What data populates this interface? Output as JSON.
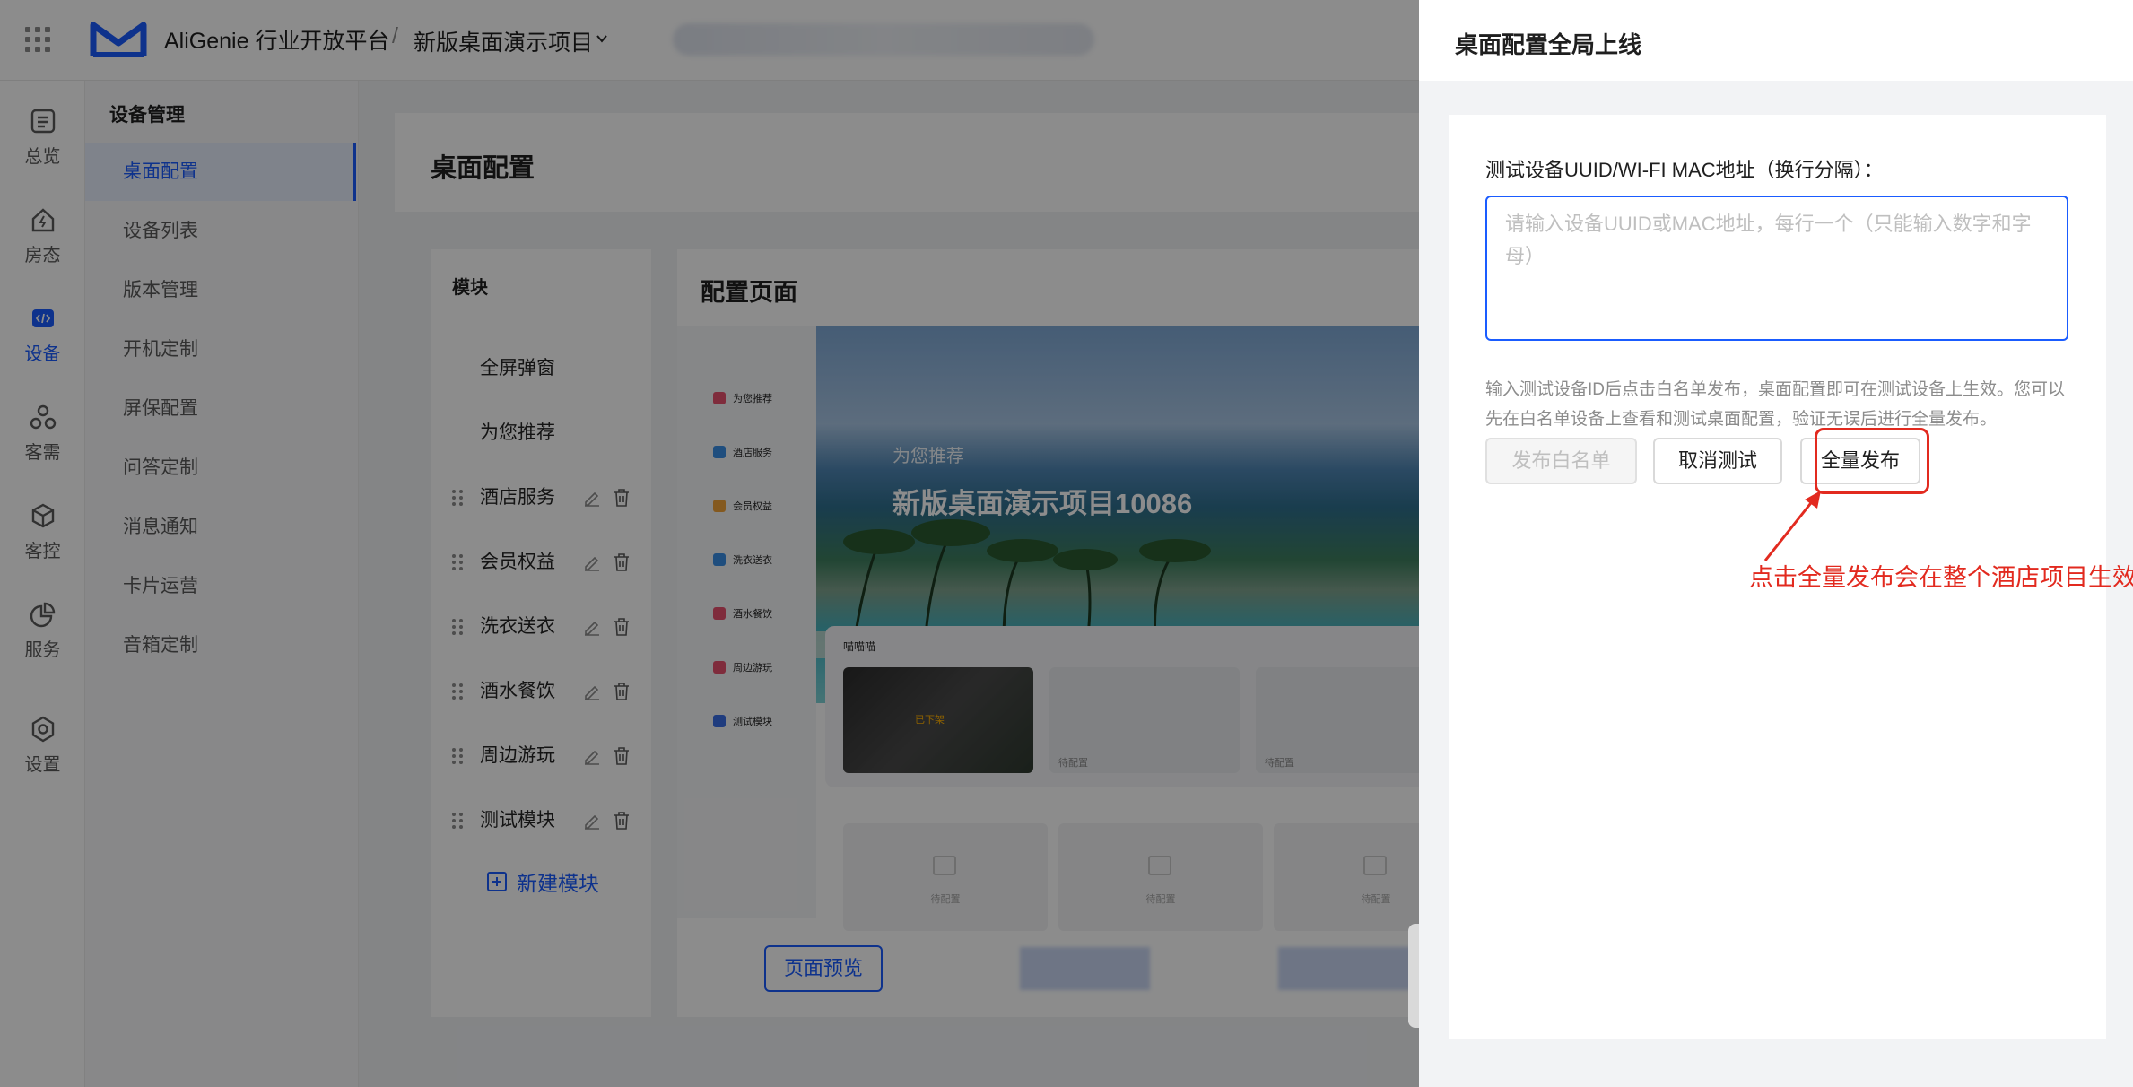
{
  "topbar": {
    "brand": "AliGenie 行业开放平台",
    "separator": "/",
    "project": "新版桌面演示项目"
  },
  "rail": {
    "items": [
      {
        "label": "总览",
        "icon": "overview-icon"
      },
      {
        "label": "房态",
        "icon": "house-icon"
      },
      {
        "label": "设备",
        "icon": "code-icon"
      },
      {
        "label": "客需",
        "icon": "guest-needs-icon"
      },
      {
        "label": "客控",
        "icon": "cube-icon"
      },
      {
        "label": "服务",
        "icon": "pie-chart-icon"
      },
      {
        "label": "设置",
        "icon": "settings-icon"
      }
    ]
  },
  "subnav": {
    "title": "设备管理",
    "items": [
      "桌面配置",
      "设备列表",
      "版本管理",
      "开机定制",
      "屏保配置",
      "问答定制",
      "消息通知",
      "卡片运营",
      "音箱定制"
    ]
  },
  "page": {
    "title": "桌面配置"
  },
  "modules": {
    "header": "模块",
    "fixed": [
      "全屏弹窗",
      "为您推荐"
    ],
    "items": [
      "酒店服务",
      "会员权益",
      "洗衣送衣",
      "酒水餐饮",
      "周边游玩",
      "测试模块"
    ],
    "new_label": "新建模块"
  },
  "config": {
    "title": "配置页面",
    "mini_nav": [
      "为您推荐",
      "酒店服务",
      "会员权益",
      "洗衣送衣",
      "酒水餐饮",
      "周边游玩",
      "测试模块"
    ],
    "hero_sub": "为您推荐",
    "hero_title": "新版桌面演示项目10086",
    "strip_title": "喵喵喵",
    "badge": "已下架",
    "pending": "待配置",
    "preview_button": "页面预览"
  },
  "drawer": {
    "title": "桌面配置全局上线",
    "field_label": "测试设备UUID/WI-FI MAC地址（换行分隔）：",
    "input_placeholder": "请输入设备UUID或MAC地址，每行一个（只能输入数字和字母）",
    "input_value": "",
    "help_text": "输入测试设备ID后点击白名单发布，桌面配置即可在测试设备上生效。您可以先在白名单设备上查看和测试桌面配置，验证无误后进行全量发布。",
    "btn_whitelist": "发布白名单",
    "btn_cancel": "取消测试",
    "btn_publish": "全量发布"
  },
  "annotation": {
    "text": "点击全量发布会在整个酒店项目生效",
    "color": "#e22a1f"
  },
  "colors": {
    "accent": "#1a5cff",
    "annotation": "#e22a1f"
  }
}
